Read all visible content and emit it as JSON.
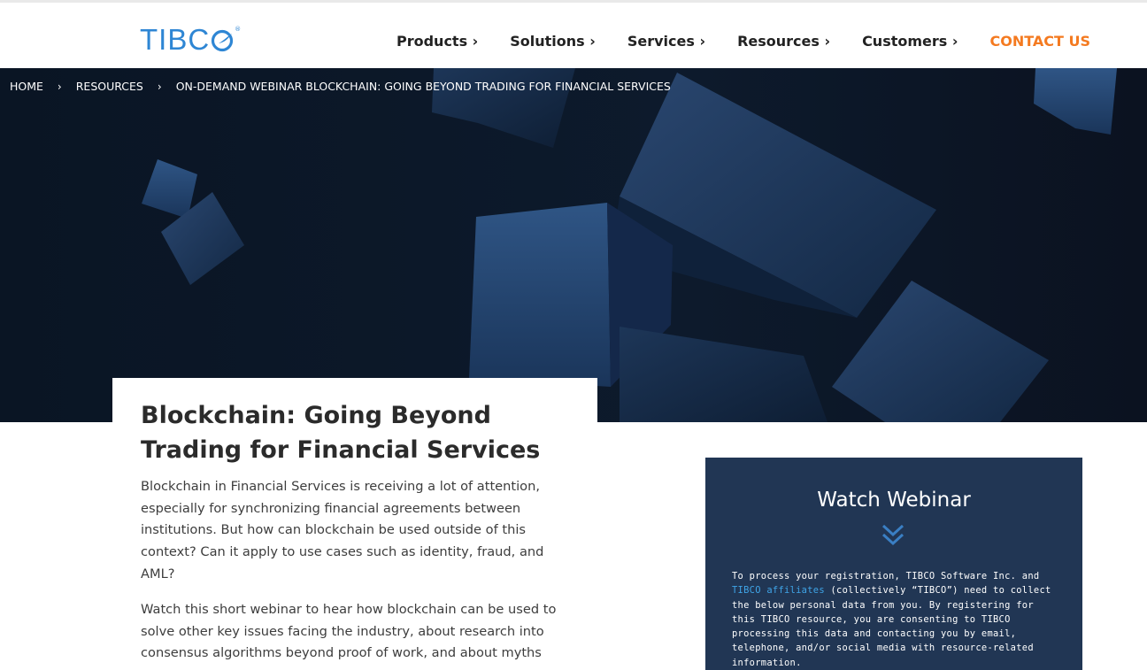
{
  "brand": {
    "logo_text": "TIBC",
    "logo_reg": "®",
    "brand_color": "#2e86d4"
  },
  "nav": {
    "items": [
      "Products ›",
      "Solutions ›",
      "Services ›",
      "Resources ›",
      "Customers ›"
    ],
    "contact": "CONTACT US",
    "contact_color": "#f47a20"
  },
  "breadcrumb": {
    "items": [
      "HOME",
      "RESOURCES",
      "ON-DEMAND WEBINAR BLOCKCHAIN: GOING BEYOND TRADING FOR FINANCIAL SERVICES"
    ],
    "separator": "›"
  },
  "article": {
    "title": "Blockchain: Going Beyond Trading for Financial Services",
    "p1": "Blockchain in Financial Services is receiving a lot of attention, especially for synchronizing financial agreements between institutions. But how can blockchain be used outside of this context? Can it apply to use cases such as identity, fraud, and AML?",
    "p2": "Watch this short webinar to hear how blockchain can be used to solve other key issues facing the industry, about research into consensus algorithms beyond proof of work, and about myths"
  },
  "webinar": {
    "title": "Watch Webinar",
    "icon": "double-chevron-down-icon",
    "consent_before": "To process your registration, TIBCO Software Inc. and ",
    "consent_link": "TIBCO affiliates",
    "consent_after": " (collectively “TIBCO”) need to collect the below personal data from you. By registering for this TIBCO resource, you are consenting to TIBCO processing this data and contacting you by email, telephone, and/or social media with resource-related information.",
    "panel_color": "#213654"
  }
}
